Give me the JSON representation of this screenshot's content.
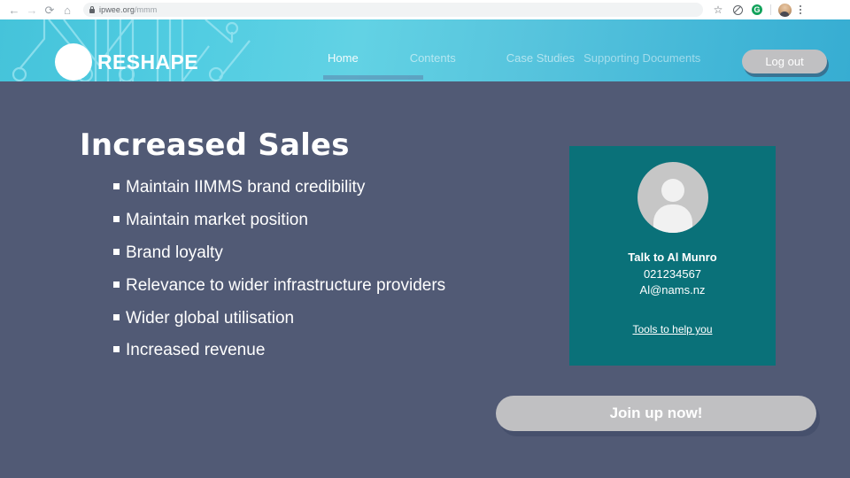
{
  "browser": {
    "back_icon": "back-arrow-icon",
    "forward_icon": "forward-arrow-icon",
    "reload_icon": "reload-icon",
    "home_icon": "home-icon",
    "url": "ipwee.org",
    "url_path": "/mmm",
    "bookmark_icon": "star-icon",
    "extension_icon": "block-icon",
    "profile_g_label": "G",
    "menu_icon": "kebab-menu-icon"
  },
  "header": {
    "brand": "RESHAPE",
    "nav": [
      {
        "label": "Home",
        "active": true
      },
      {
        "label": "Contents",
        "active": false
      },
      {
        "label": "Case Studies",
        "active": false
      },
      {
        "label": "Supporting Documents",
        "active": false
      }
    ],
    "logout_label": "Log out",
    "gradient_from": "#45c3da",
    "gradient_to": "#37add2"
  },
  "slide": {
    "title": "Increased Sales",
    "background": "#515a75",
    "bullets": [
      "Maintain IIMMS brand credibility",
      "Maintain market position",
      "Brand loyalty",
      "Relevance to wider infrastructure providers",
      "Wider global utilisation",
      "Increased revenue"
    ]
  },
  "contact_card": {
    "background": "#0a7179",
    "avatar_icon": "person-placeholder-icon",
    "name": "Talk to Al Munro",
    "phone": "021234567",
    "email": "Al@nams.nz",
    "link_label": "Tools to help you"
  },
  "cta": {
    "label": "Join up now!",
    "color": "#c0c0c2"
  }
}
